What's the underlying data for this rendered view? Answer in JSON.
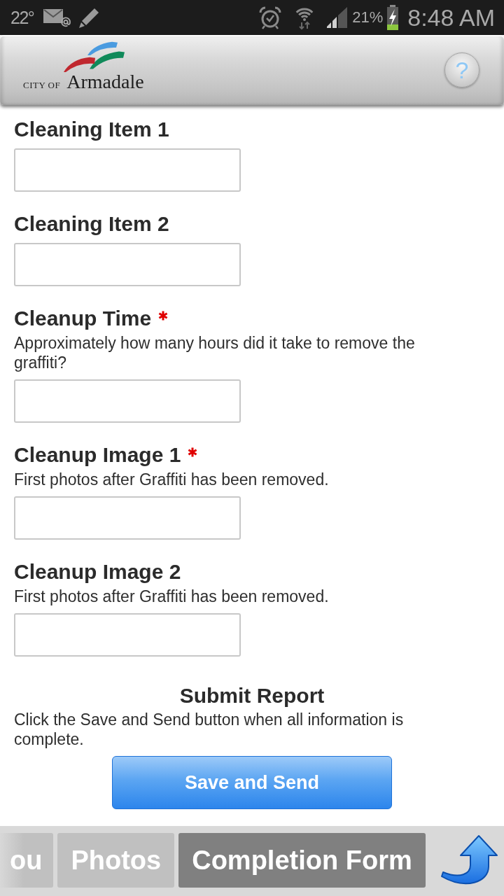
{
  "status_bar": {
    "temperature": "22°",
    "battery": "21%",
    "time": "8:48 AM"
  },
  "header": {
    "logo_prefix": "CITY OF",
    "logo_name": "Armadale",
    "help_button": "?"
  },
  "form": {
    "fields": [
      {
        "label": "Cleaning Item 1",
        "required": false
      },
      {
        "label": "Cleaning Item 2",
        "required": false
      },
      {
        "label": "Cleanup Time",
        "required": true,
        "description": "Approximately how many hours did it take to remove the graffiti?"
      },
      {
        "label": "Cleanup Image 1",
        "required": true,
        "description": "First photos after Graffiti has been removed."
      },
      {
        "label": "Cleanup Image 2",
        "required": false,
        "description": "First photos after Graffiti has been removed."
      }
    ],
    "submit": {
      "title": "Submit Report",
      "description": "Click the Save and Send button when all information is complete.",
      "button": "Save and Send"
    }
  },
  "tabs": [
    {
      "label": "ou",
      "selected": false
    },
    {
      "label": "Photos",
      "selected": false
    },
    {
      "label": "Completion Form",
      "selected": true
    }
  ]
}
